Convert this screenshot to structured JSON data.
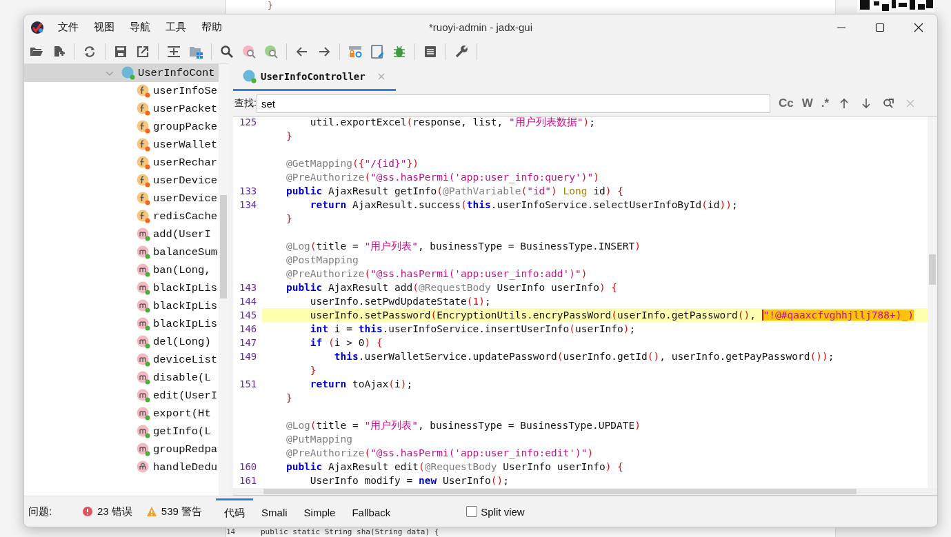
{
  "background": {
    "top_code": "}",
    "bottom_line_number": "14",
    "bottom_code": "public static String sha(String data) {"
  },
  "window": {
    "title": "*ruoyi-admin - jadx-gui"
  },
  "menu": [
    "文件",
    "视图",
    "导航",
    "工具",
    "帮助"
  ],
  "tree": [
    {
      "label": "UserInfoCont",
      "kind": "class",
      "expanded": true,
      "selected": true,
      "children": [
        {
          "label": "userInfoSe",
          "kind": "field"
        },
        {
          "label": "userPacket",
          "kind": "field"
        },
        {
          "label": "groupPacke",
          "kind": "field"
        },
        {
          "label": "userWallet",
          "kind": "field"
        },
        {
          "label": "userRechar",
          "kind": "field"
        },
        {
          "label": "userDevice",
          "kind": "field"
        },
        {
          "label": "userDevice",
          "kind": "field"
        },
        {
          "label": "redisCache",
          "kind": "field"
        },
        {
          "label": "add(UserI",
          "kind": "method"
        },
        {
          "label": "balanceSum",
          "kind": "method"
        },
        {
          "label": "ban(Long,",
          "kind": "method"
        },
        {
          "label": "blackIpLis",
          "kind": "method"
        },
        {
          "label": "blackIpLis",
          "kind": "method"
        },
        {
          "label": "blackIpLis",
          "kind": "method"
        },
        {
          "label": "del(Long)",
          "kind": "method"
        },
        {
          "label": "deviceList",
          "kind": "method"
        },
        {
          "label": "disable(L",
          "kind": "method"
        },
        {
          "label": "edit(UserI",
          "kind": "method"
        },
        {
          "label": "export(Ht",
          "kind": "method"
        },
        {
          "label": "getInfo(L",
          "kind": "method"
        },
        {
          "label": "groupRedpa",
          "kind": "method"
        },
        {
          "label": "handleDedu",
          "kind": "private_method"
        }
      ]
    }
  ],
  "tabs": [
    {
      "label": "UserInfoController",
      "selected": true
    }
  ],
  "find": {
    "label": "查找:",
    "value": "set",
    "options": [
      "Cc",
      "W",
      ".*"
    ]
  },
  "code": [
    {
      "num": "125",
      "current": false,
      "tokens": [
        {
          "kind": "plain",
          "text": "        util.exportExcel"
        },
        {
          "kind": "p",
          "text": "("
        },
        {
          "kind": "plain",
          "text": "response, list, "
        },
        {
          "kind": "str",
          "text": "\"用户列表数据\""
        },
        {
          "kind": "p",
          "text": ")"
        },
        {
          "kind": "plain",
          "text": ";"
        }
      ]
    },
    {
      "current": false,
      "tokens": [
        {
          "kind": "p",
          "text": "    }"
        }
      ]
    },
    {
      "current": false
    },
    {
      "current": false,
      "tokens": [
        {
          "kind": "ann",
          "text": "    @GetMapping"
        },
        {
          "kind": "p",
          "text": "({"
        },
        {
          "kind": "str",
          "text": "\"/{id}\""
        },
        {
          "kind": "p",
          "text": "})"
        }
      ]
    },
    {
      "current": false,
      "tokens": [
        {
          "kind": "ann",
          "text": "    @PreAuthorize"
        },
        {
          "kind": "p",
          "text": "("
        },
        {
          "kind": "str",
          "text": "\"@ss.hasPermi('app:user_info:query')\""
        },
        {
          "kind": "p",
          "text": ")"
        }
      ]
    },
    {
      "num": "133",
      "current": false,
      "tokens": [
        {
          "kind": "kw",
          "text": "    public"
        },
        {
          "kind": "plain",
          "text": " AjaxResult getInfo"
        },
        {
          "kind": "p",
          "text": "("
        },
        {
          "kind": "ann",
          "text": "@PathVariable"
        },
        {
          "kind": "p",
          "text": "("
        },
        {
          "kind": "str",
          "text": "\"id\""
        },
        {
          "kind": "p",
          "text": ")"
        },
        {
          "kind": "type",
          "text": " Long"
        },
        {
          "kind": "plain",
          "text": " id"
        },
        {
          "kind": "p",
          "text": ") {"
        }
      ]
    },
    {
      "num": "134",
      "current": false,
      "tokens": [
        {
          "kind": "kw",
          "text": "        return"
        },
        {
          "kind": "plain",
          "text": " AjaxResult.success"
        },
        {
          "kind": "p",
          "text": "("
        },
        {
          "kind": "kw",
          "text": "this"
        },
        {
          "kind": "plain",
          "text": ".userInfoService.selectUserInfoById"
        },
        {
          "kind": "p",
          "text": "("
        },
        {
          "kind": "plain",
          "text": "id"
        },
        {
          "kind": "p",
          "text": "))"
        },
        {
          "kind": "plain",
          "text": ";"
        }
      ]
    },
    {
      "current": false,
      "tokens": [
        {
          "kind": "p",
          "text": "    }"
        }
      ]
    },
    {
      "current": false
    },
    {
      "current": false,
      "tokens": [
        {
          "kind": "ann",
          "text": "    @Log"
        },
        {
          "kind": "p",
          "text": "("
        },
        {
          "kind": "plain",
          "text": "title = "
        },
        {
          "kind": "str",
          "text": "\"用户列表\""
        },
        {
          "kind": "plain",
          "text": ", businessType = BusinessType.INSERT"
        },
        {
          "kind": "p",
          "text": ")"
        }
      ]
    },
    {
      "current": false,
      "tokens": [
        {
          "kind": "ann",
          "text": "    @PostMapping"
        }
      ]
    },
    {
      "current": false,
      "tokens": [
        {
          "kind": "ann",
          "text": "    @PreAuthorize"
        },
        {
          "kind": "p",
          "text": "("
        },
        {
          "kind": "str",
          "text": "\"@ss.hasPermi('app:user_info:add')\""
        },
        {
          "kind": "p",
          "text": ")"
        }
      ]
    },
    {
      "num": "143",
      "current": false,
      "tokens": [
        {
          "kind": "kw",
          "text": "    public"
        },
        {
          "kind": "plain",
          "text": " AjaxResult add"
        },
        {
          "kind": "p",
          "text": "("
        },
        {
          "kind": "ann",
          "text": "@RequestBody"
        },
        {
          "kind": "plain",
          "text": " UserInfo userInfo"
        },
        {
          "kind": "p",
          "text": ") {"
        }
      ]
    },
    {
      "num": "144",
      "current": false,
      "tokens": [
        {
          "kind": "plain",
          "text": "        userInfo.setPwdUpdateState"
        },
        {
          "kind": "p",
          "text": "(1)"
        },
        {
          "kind": "plain",
          "text": ";"
        }
      ]
    },
    {
      "num": "145",
      "current": true,
      "tokens": [
        {
          "kind": "plain",
          "text": "        userInfo.setPassword"
        },
        {
          "kind": "p",
          "text": "("
        },
        {
          "kind": "plain",
          "text": "EncryptionUtils.encryPassWord"
        },
        {
          "kind": "p",
          "text": "("
        },
        {
          "kind": "plain",
          "text": "userInfo.getPassword"
        },
        {
          "kind": "p",
          "text": "()"
        },
        {
          "kind": "plain",
          "text": ", "
        },
        {
          "kind": "match",
          "text": "\"!@#qaaxcfvghhjllj788+)_)"
        }
      ]
    },
    {
      "num": "146",
      "current": false,
      "tokens": [
        {
          "kind": "kw",
          "text": "        int"
        },
        {
          "kind": "plain",
          "text": " i = "
        },
        {
          "kind": "kw",
          "text": "this"
        },
        {
          "kind": "plain",
          "text": ".userInfoService.insertUserInfo"
        },
        {
          "kind": "p",
          "text": "("
        },
        {
          "kind": "plain",
          "text": "userInfo"
        },
        {
          "kind": "p",
          "text": ")"
        },
        {
          "kind": "plain",
          "text": ";"
        }
      ]
    },
    {
      "num": "147",
      "current": false,
      "tokens": [
        {
          "kind": "kw",
          "text": "        if"
        },
        {
          "kind": "p",
          "text": " ("
        },
        {
          "kind": "plain",
          "text": "i > 0"
        },
        {
          "kind": "p",
          "text": ") {"
        }
      ]
    },
    {
      "num": "149",
      "current": false,
      "tokens": [
        {
          "kind": "kw",
          "text": "            this"
        },
        {
          "kind": "plain",
          "text": ".userWalletService.updatePassword"
        },
        {
          "kind": "p",
          "text": "("
        },
        {
          "kind": "plain",
          "text": "userInfo.getId"
        },
        {
          "kind": "p",
          "text": "()"
        },
        {
          "kind": "plain",
          "text": ", userInfo.getPayPassword"
        },
        {
          "kind": "p",
          "text": "())"
        },
        {
          "kind": "plain",
          "text": ";"
        }
      ]
    },
    {
      "current": false,
      "tokens": [
        {
          "kind": "p",
          "text": "        }"
        }
      ]
    },
    {
      "num": "151",
      "current": false,
      "tokens": [
        {
          "kind": "kw",
          "text": "        return"
        },
        {
          "kind": "plain",
          "text": " toAjax"
        },
        {
          "kind": "p",
          "text": "("
        },
        {
          "kind": "plain",
          "text": "i"
        },
        {
          "kind": "p",
          "text": ")"
        },
        {
          "kind": "plain",
          "text": ";"
        }
      ]
    },
    {
      "current": false,
      "tokens": [
        {
          "kind": "p",
          "text": "    }"
        }
      ]
    },
    {
      "current": false
    },
    {
      "current": false,
      "tokens": [
        {
          "kind": "ann",
          "text": "    @Log"
        },
        {
          "kind": "p",
          "text": "("
        },
        {
          "kind": "plain",
          "text": "title = "
        },
        {
          "kind": "str",
          "text": "\"用户列表\""
        },
        {
          "kind": "plain",
          "text": ", businessType = BusinessType.UPDATE"
        },
        {
          "kind": "p",
          "text": ")"
        }
      ]
    },
    {
      "current": false,
      "tokens": [
        {
          "kind": "ann",
          "text": "    @PutMapping"
        }
      ]
    },
    {
      "current": false,
      "tokens": [
        {
          "kind": "ann",
          "text": "    @PreAuthorize"
        },
        {
          "kind": "p",
          "text": "("
        },
        {
          "kind": "str",
          "text": "\"@ss.hasPermi('app:user_info:edit')\""
        },
        {
          "kind": "p",
          "text": ")"
        }
      ]
    },
    {
      "num": "160",
      "current": false,
      "tokens": [
        {
          "kind": "kw",
          "text": "    public"
        },
        {
          "kind": "plain",
          "text": " AjaxResult edit"
        },
        {
          "kind": "p",
          "text": "("
        },
        {
          "kind": "ann",
          "text": "@RequestBody"
        },
        {
          "kind": "plain",
          "text": " UserInfo userInfo"
        },
        {
          "kind": "p",
          "text": ") {"
        }
      ]
    },
    {
      "num": "161",
      "current": false,
      "tokens": [
        {
          "kind": "plain",
          "text": "        UserInfo modify = "
        },
        {
          "kind": "kw",
          "text": "new"
        },
        {
          "kind": "plain",
          "text": " UserInfo"
        },
        {
          "kind": "p",
          "text": "()"
        },
        {
          "kind": "plain",
          "text": ";"
        }
      ]
    }
  ],
  "status": {
    "label": "问题:",
    "errors": "23 错误",
    "warnings": "539 警告"
  },
  "view_tabs": [
    {
      "label": "代码",
      "selected": true
    },
    {
      "label": "Smali",
      "selected": false
    },
    {
      "label": "Simple",
      "selected": false
    },
    {
      "label": "Fallback",
      "selected": false
    }
  ],
  "split_view": {
    "label": "Split view",
    "checked": false
  }
}
